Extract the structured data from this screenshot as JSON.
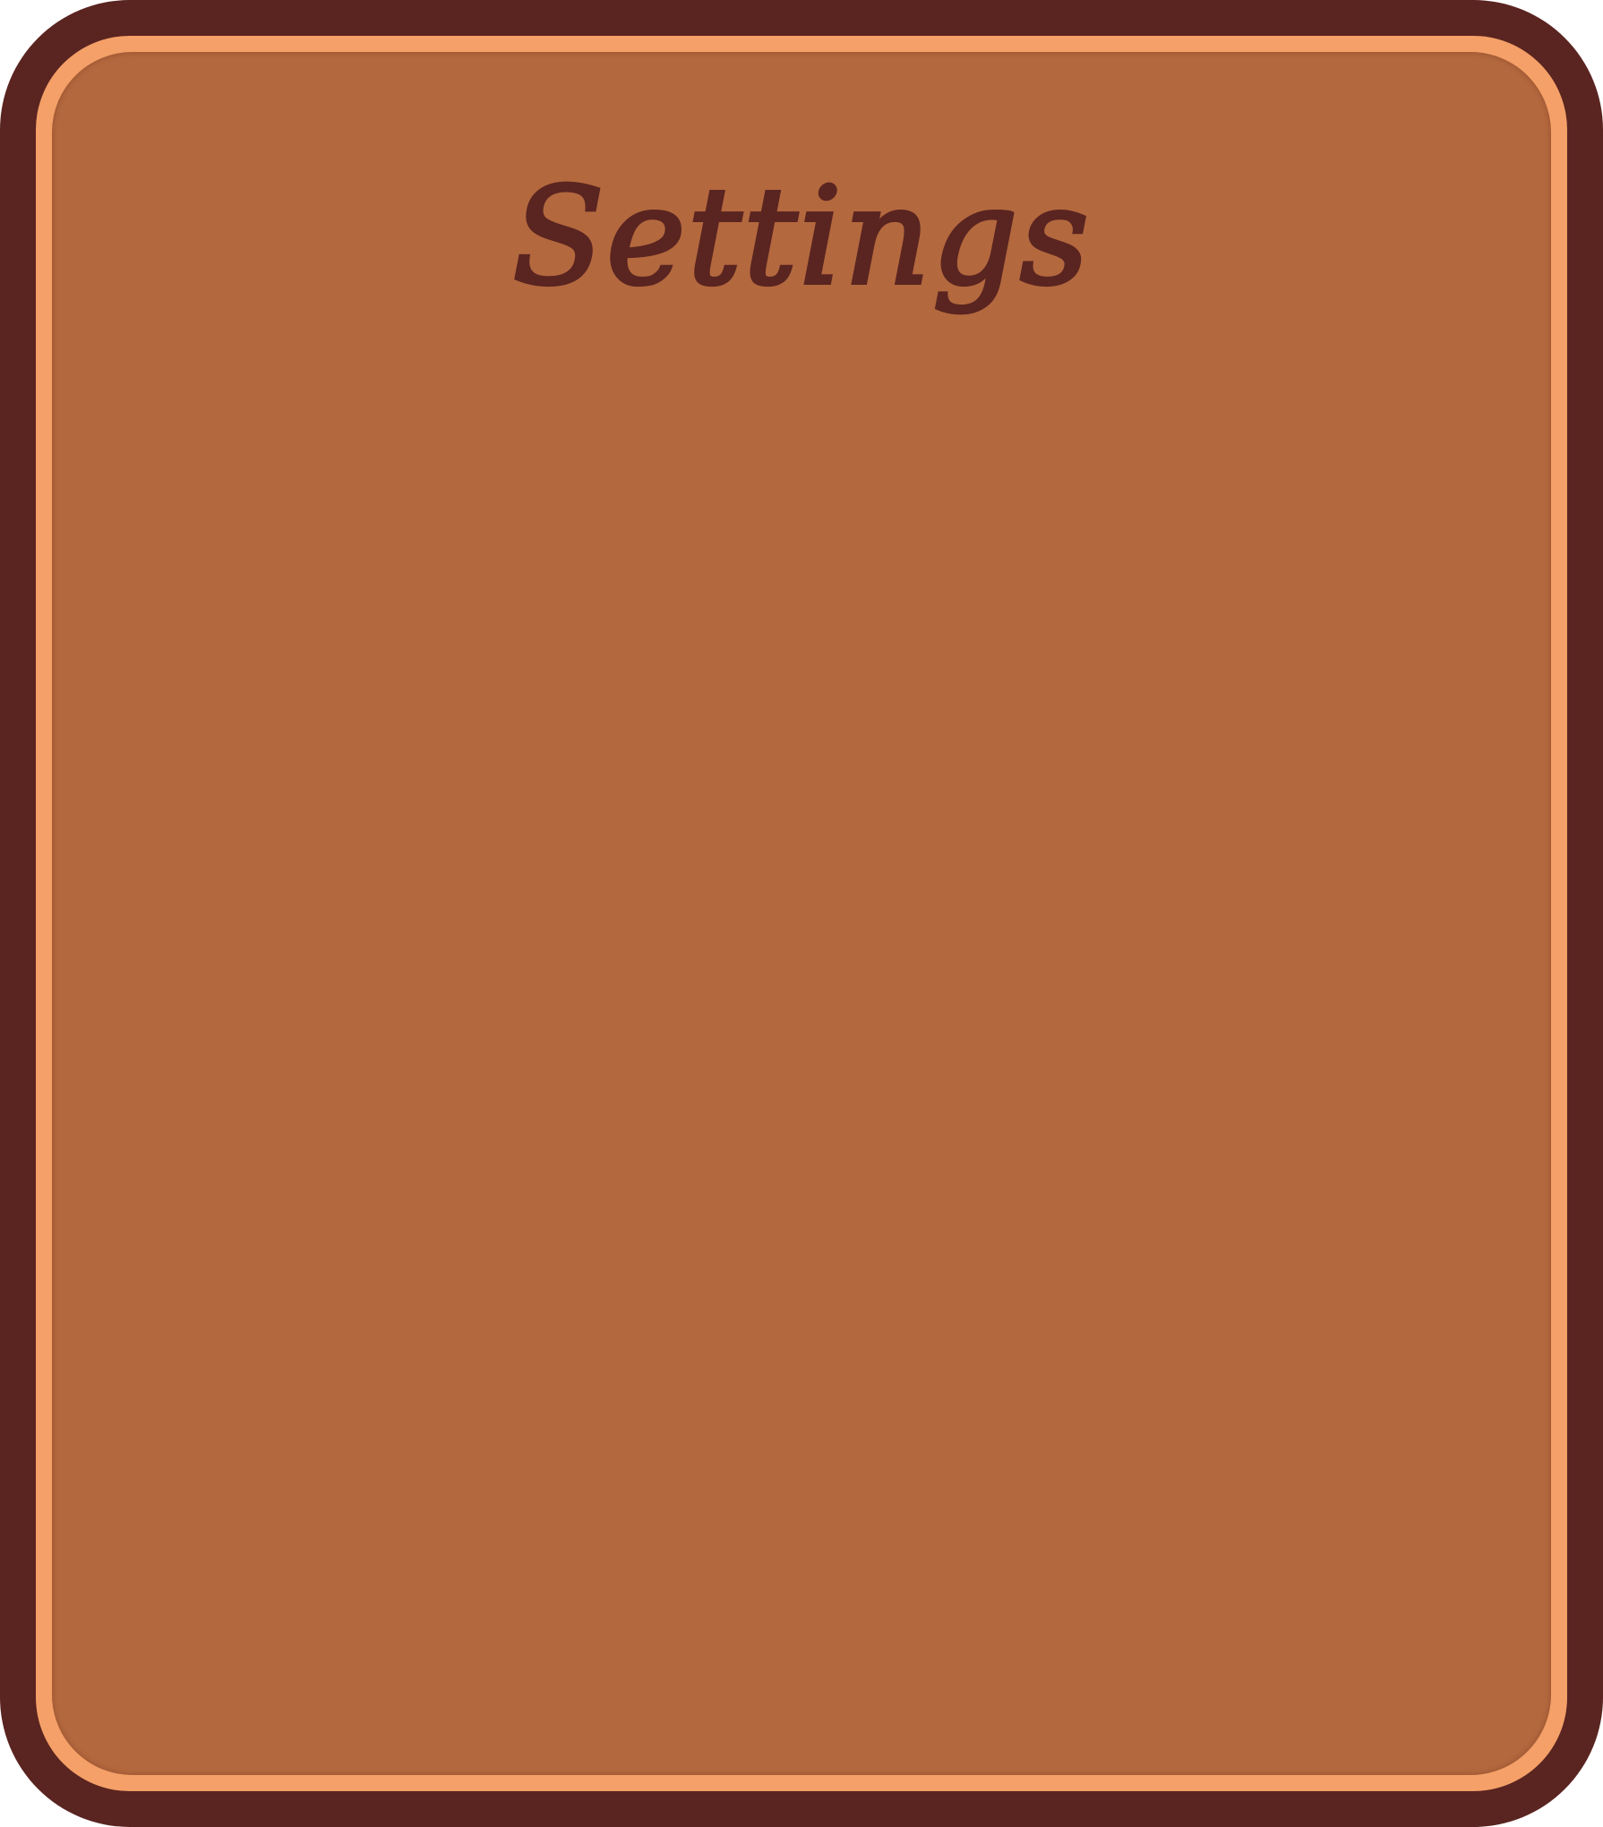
{
  "settings_panel": {
    "title": "Settings"
  },
  "colors": {
    "frame_dark": "#5a2420",
    "frame_rim": "#f5a068",
    "panel_fill": "#b3683e",
    "title_text": "#5a2420"
  }
}
